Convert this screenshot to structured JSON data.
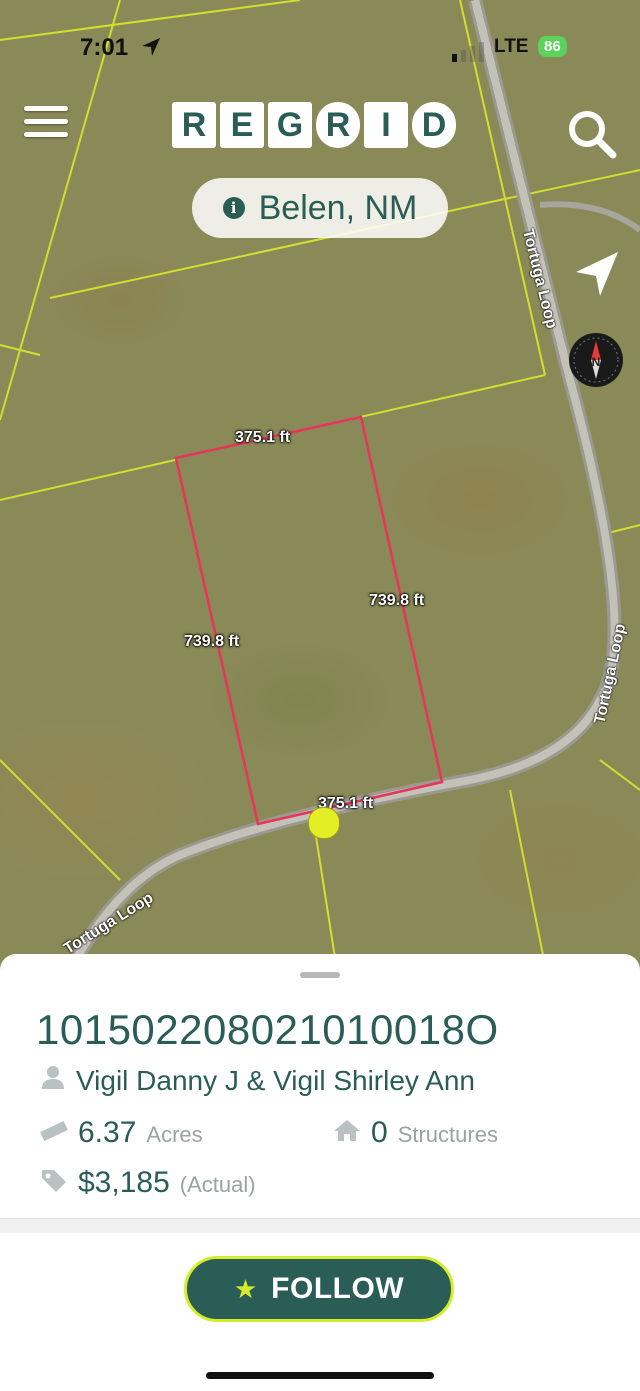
{
  "status_bar": {
    "time": "7:01",
    "network": "LTE",
    "battery": "86"
  },
  "header": {
    "logo_letters": [
      "R",
      "E",
      "G",
      "R",
      "I",
      "D"
    ],
    "place": "Belen, NM"
  },
  "map": {
    "streets": [
      "Tortuga Loop",
      "Tortuga Loop",
      "Tortuga Loop"
    ],
    "dimensions": {
      "top": "375.1 ft",
      "left": "739.8 ft",
      "right": "739.8 ft",
      "bottom": "375.1 ft"
    },
    "colors": {
      "parcel_outline": "#e8345a",
      "parcel_lines": "#d9e82c",
      "road": "#b8b8b0",
      "pin": "#e4ee24"
    }
  },
  "parcel": {
    "id": "101502208021010018O",
    "owner": "Vigil Danny J & Vigil Shirley Ann",
    "acres_value": "6.37",
    "acres_unit": "Acres",
    "structures_value": "0",
    "structures_unit": "Structures",
    "price_value": "$3,185",
    "price_note": "(Actual)"
  },
  "follow_label": "FOLLOW",
  "colors": {
    "brand": "#2a5d55",
    "accent": "#d6ec2a"
  }
}
